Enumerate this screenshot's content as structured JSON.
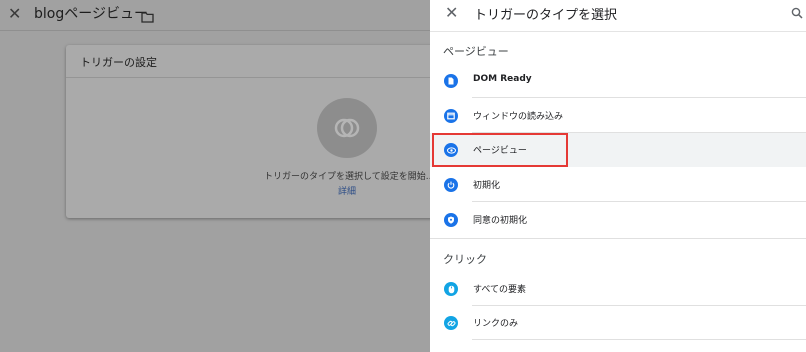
{
  "background": {
    "title": "blogページビュー",
    "card_title": "トリガーの設定",
    "card_hint": "トリガーのタイプを選択して設定を開始...",
    "card_link": "詳細"
  },
  "panel": {
    "title": "トリガーのタイプを選択",
    "sections": [
      {
        "label": "ページビュー",
        "items": [
          {
            "label": "DOM Ready",
            "icon": "document-icon"
          },
          {
            "label": "ウィンドウの読み込み",
            "icon": "window-icon"
          },
          {
            "label": "ページビュー",
            "icon": "eye-icon",
            "selected": true
          },
          {
            "label": "初期化",
            "icon": "power-icon"
          },
          {
            "label": "同意の初期化",
            "icon": "shield-icon"
          }
        ]
      },
      {
        "label": "クリック",
        "items": [
          {
            "label": "すべての要素",
            "icon": "mouse-icon"
          },
          {
            "label": "リンクのみ",
            "icon": "link-icon"
          }
        ]
      }
    ]
  },
  "colors": {
    "accent": "#1a73e8",
    "click_accent": "#12a4e4",
    "highlight": "#e53935",
    "overlay": "#a1a1a1"
  }
}
